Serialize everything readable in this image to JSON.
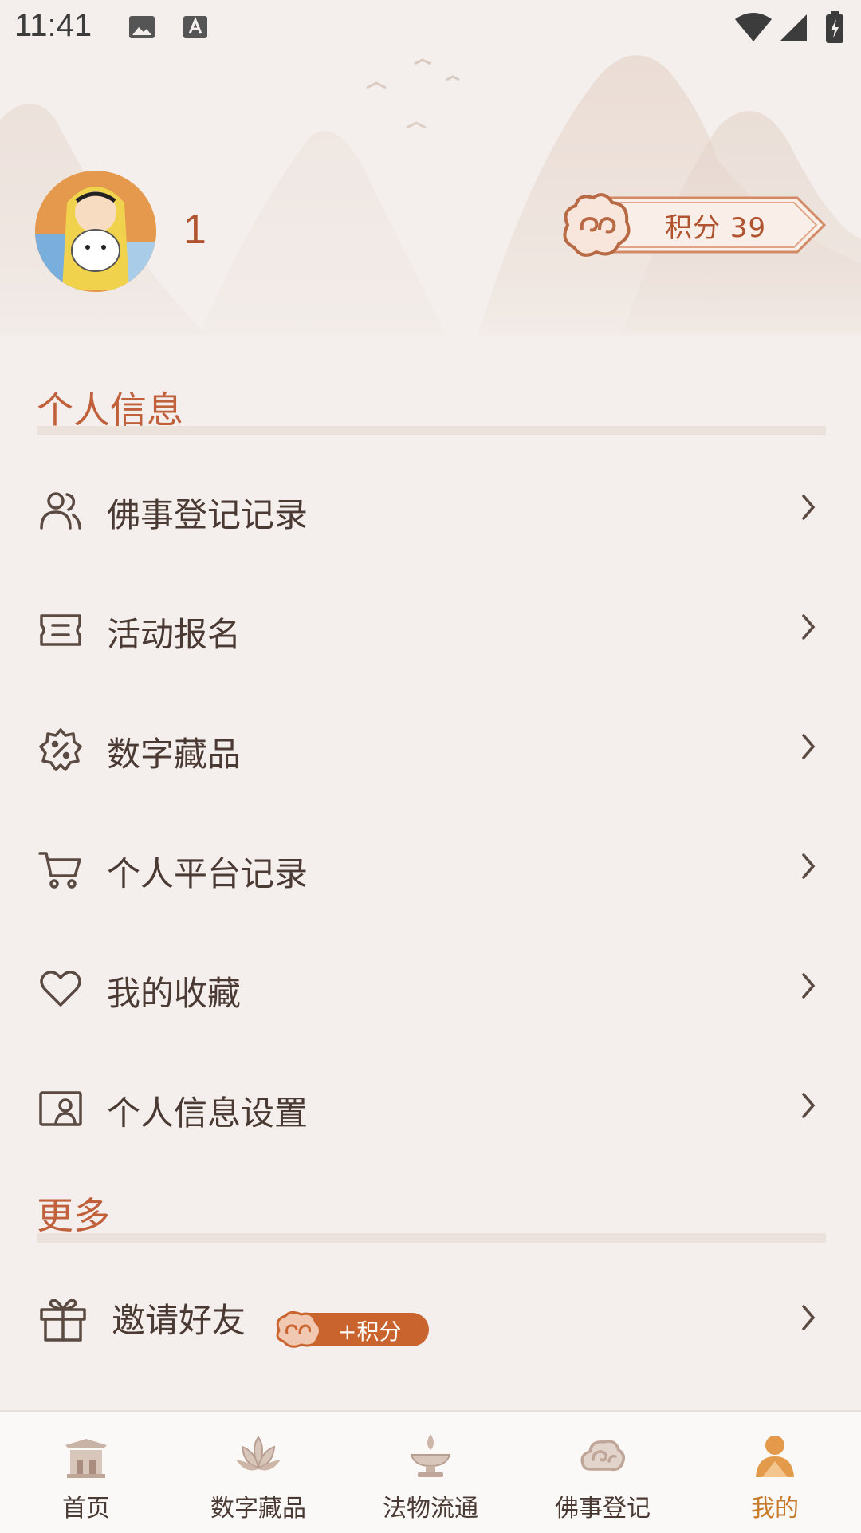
{
  "status_bar": {
    "time": "11:41"
  },
  "profile": {
    "username": "1",
    "points_label": "积分 39"
  },
  "sections": {
    "personal_title": "个人信息",
    "more_title": "更多"
  },
  "menu": {
    "items": [
      {
        "label": "佛事登记记录",
        "icon": "people-icon"
      },
      {
        "label": "活动报名",
        "icon": "ticket-icon"
      },
      {
        "label": "数字藏品",
        "icon": "discount-badge-icon"
      },
      {
        "label": "个人平台记录",
        "icon": "cart-icon"
      },
      {
        "label": "我的收藏",
        "icon": "heart-icon"
      },
      {
        "label": "个人信息设置",
        "icon": "id-card-icon"
      }
    ],
    "invite": {
      "label": "邀请好友",
      "badge": "+积分",
      "icon": "gift-icon"
    }
  },
  "bottom_nav": {
    "items": [
      {
        "label": "首页",
        "icon": "temple-icon"
      },
      {
        "label": "数字藏品",
        "icon": "lotus-icon"
      },
      {
        "label": "法物流通",
        "icon": "oil-lamp-icon"
      },
      {
        "label": "佛事登记",
        "icon": "cloud-icon"
      },
      {
        "label": "我的",
        "icon": "monk-icon",
        "active": true
      }
    ],
    "active_color": "#c77a2a"
  },
  "colors": {
    "accent": "#c0613c",
    "text": "#4a3a33",
    "background": "#f4efec"
  }
}
